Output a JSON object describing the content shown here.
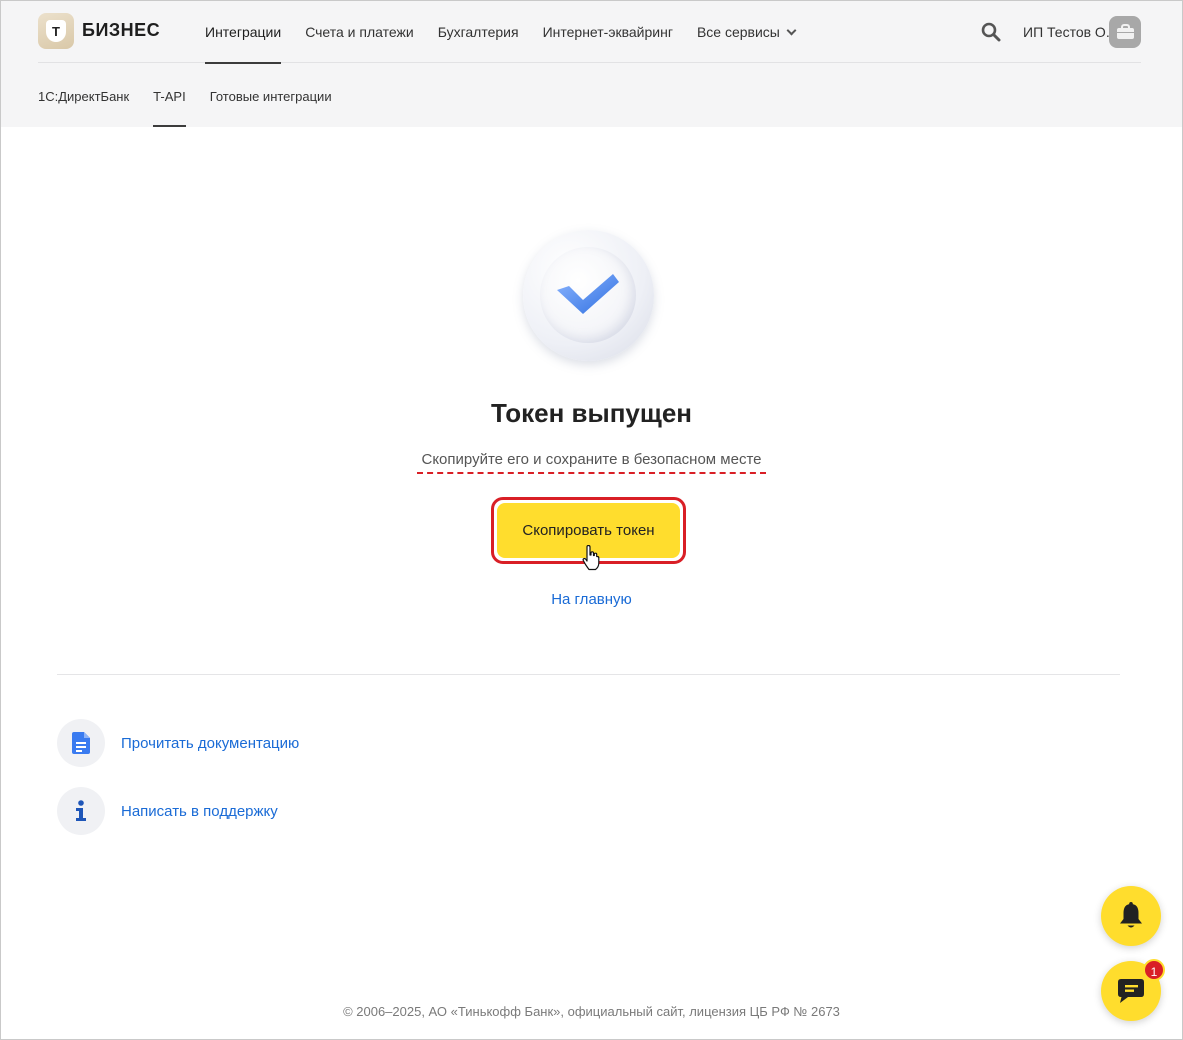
{
  "brand": {
    "logo_letter": "Т",
    "name": "БИЗНЕС"
  },
  "header": {
    "nav": [
      {
        "label": "Интеграции",
        "active": true
      },
      {
        "label": "Счета и платежи",
        "active": false
      },
      {
        "label": "Бухгалтерия",
        "active": false
      },
      {
        "label": "Интернет-эквайринг",
        "active": false
      },
      {
        "label": "Все сервисы",
        "active": false,
        "dropdown": true
      }
    ],
    "user_name": "ИП Тестов О.",
    "icons": {
      "search": "search-icon",
      "avatar": "briefcase-icon"
    }
  },
  "subnav": [
    {
      "label": "1С:ДиректБанк",
      "active": false
    },
    {
      "label": "T-API",
      "active": true
    },
    {
      "label": "Готовые интеграции",
      "active": false
    }
  ],
  "main": {
    "status_icon": "checkmark-icon",
    "title": "Токен выпущен",
    "subtitle": "Скопируйте его и сохраните в безопасном месте",
    "copy_button": "Скопировать токен",
    "home_link": "На главную"
  },
  "help": [
    {
      "icon": "document-icon",
      "label": "Прочитать документацию"
    },
    {
      "icon": "info-icon",
      "label": "Написать в поддержку"
    }
  ],
  "footer": {
    "text": "© 2006–2025, АО «Тинькофф Банк», официальный сайт, лицензия ЦБ РФ № 2673"
  },
  "floating": {
    "bell_icon": "bell-icon",
    "chat_icon": "chat-icon",
    "chat_badge": "1"
  },
  "colors": {
    "accent": "#ffdd2d",
    "link": "#1a6bd6",
    "highlight": "#d91f26",
    "header_bg": "#f5f5f6"
  }
}
